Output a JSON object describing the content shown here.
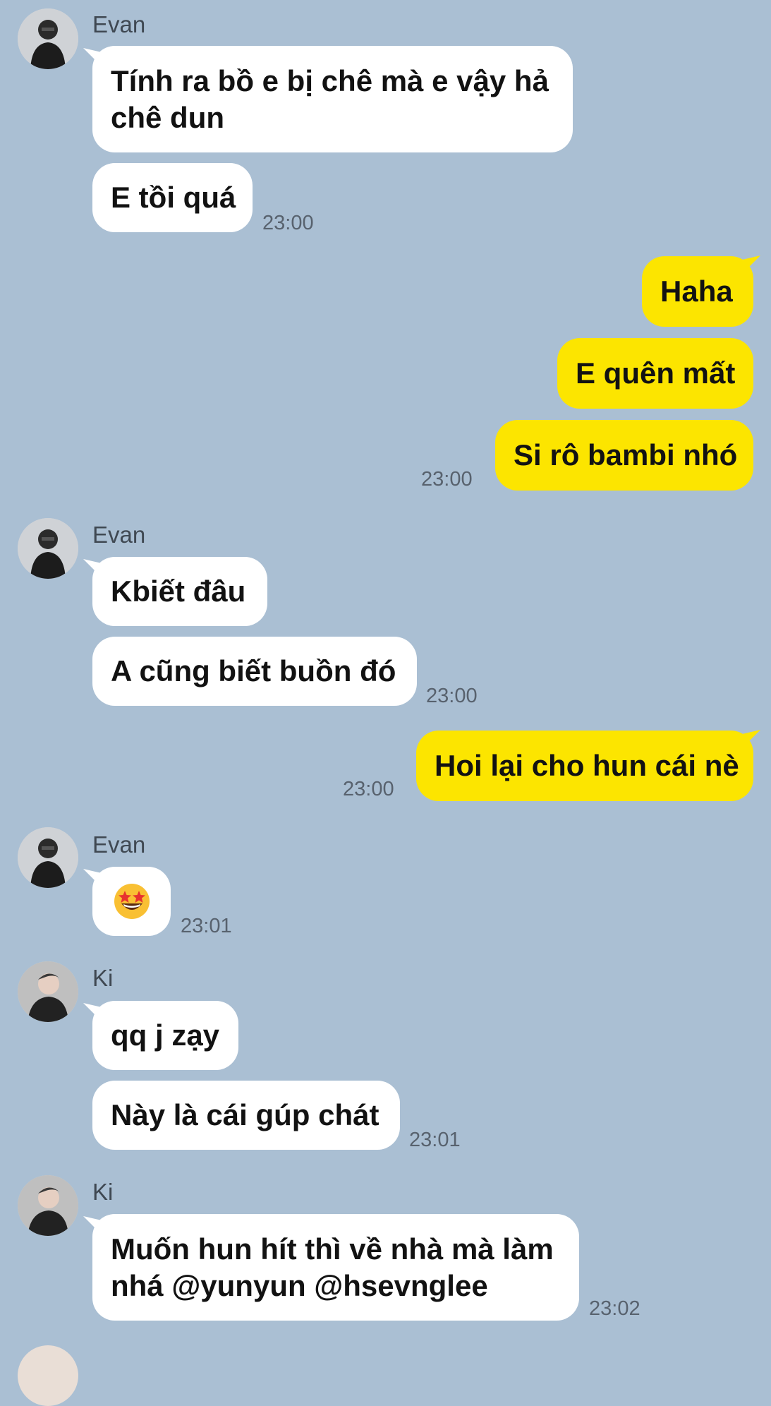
{
  "messages": {
    "evan_name_1": "Evan",
    "evan_1a": "Tính ra bồ e bị chê mà e vậy hả chê dun",
    "evan_1b": "E tồi quá",
    "evan_1_time": "23:00",
    "me_1a": "Haha",
    "me_1b": "E quên mất",
    "me_1c": "Si rô bambi nhó",
    "me_1_time": "23:00",
    "evan_name_2": "Evan",
    "evan_2a": "Kbiết đâu",
    "evan_2b": "A cũng biết buồn đó",
    "evan_2_time": "23:00",
    "me_2a": "Hoi lại cho hun cái nè",
    "me_2_time": "23:00",
    "evan_name_3": "Evan",
    "evan_3_emoji": "star-struck-emoji",
    "evan_3_time": "23:01",
    "ki_name_1": "Ki",
    "ki_1a": "qq j zạy",
    "ki_1b": "Này là cái gúp chát",
    "ki_1_time": "23:01",
    "ki_name_2": "Ki",
    "ki_2a": "Muốn hun hít thì về nhà mà làm nhá @yunyun @hsevnglee",
    "ki_2_time": "23:02"
  },
  "colors": {
    "background": "#aabfd3",
    "incoming_bubble": "#ffffff",
    "outgoing_bubble": "#fce500",
    "timestamp": "#58626e"
  }
}
